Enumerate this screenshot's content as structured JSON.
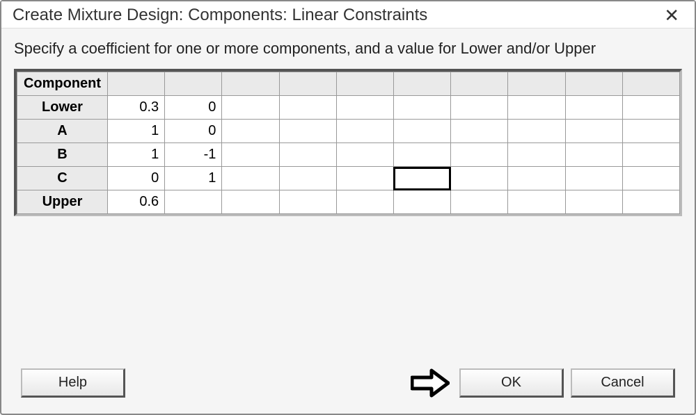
{
  "dialog": {
    "title": "Create Mixture Design: Components: Linear Constraints",
    "instruction": "Specify a coefficient for one or more components, and a value for Lower and/or Upper"
  },
  "table": {
    "header_label": "Component",
    "num_value_cols": 10,
    "rows": [
      {
        "label": "Lower",
        "cells": [
          "0.3",
          "0",
          "",
          "",
          "",
          "",
          "",
          "",
          "",
          ""
        ]
      },
      {
        "label": "A",
        "cells": [
          "1",
          "0",
          "",
          "",
          "",
          "",
          "",
          "",
          "",
          ""
        ]
      },
      {
        "label": "B",
        "cells": [
          "1",
          "-1",
          "",
          "",
          "",
          "",
          "",
          "",
          "",
          ""
        ]
      },
      {
        "label": "C",
        "cells": [
          "0",
          "1",
          "",
          "",
          "",
          "",
          "",
          "",
          "",
          ""
        ]
      },
      {
        "label": "Upper",
        "cells": [
          "0.6",
          "",
          "",
          "",
          "",
          "",
          "",
          "",
          "",
          ""
        ]
      }
    ],
    "selected_cell": {
      "row": 3,
      "col": 5
    }
  },
  "buttons": {
    "help": "Help",
    "ok": "OK",
    "cancel": "Cancel"
  }
}
